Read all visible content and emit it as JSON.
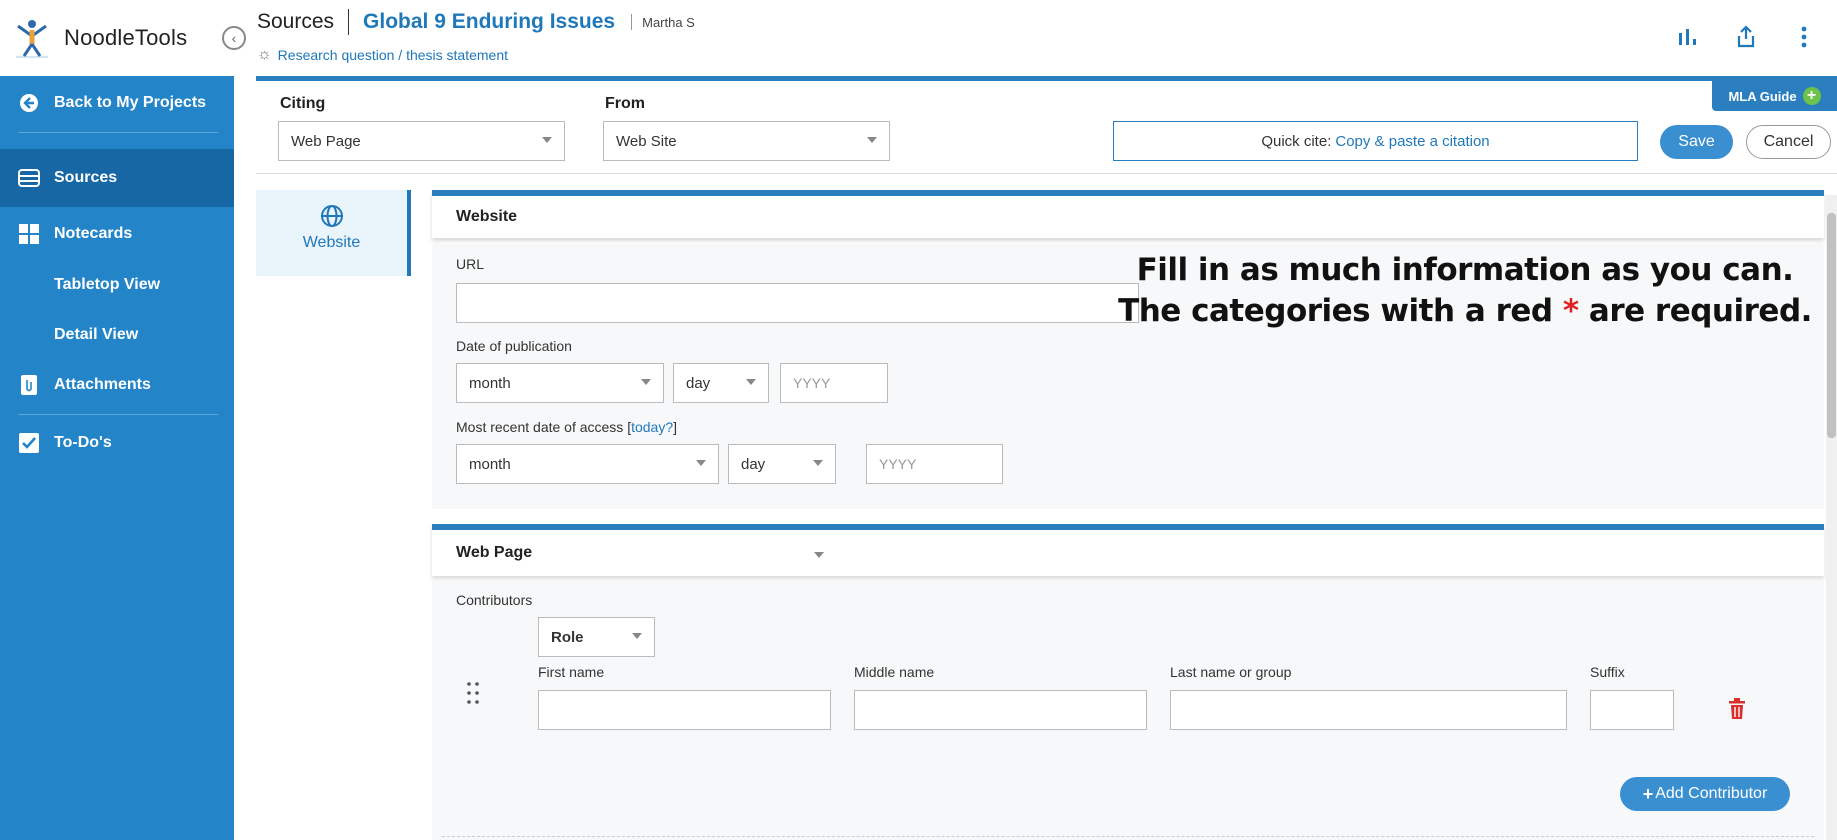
{
  "header": {
    "app_name": "NoodleTools",
    "section": "Sources",
    "project_title": "Global 9 Enduring Issues",
    "user_name": "Martha S",
    "research_link": "Research question / thesis statement",
    "icons": [
      "bar-chart-icon",
      "share-icon",
      "more-vert-icon"
    ]
  },
  "sidebar": {
    "back": "Back to My Projects",
    "sources": "Sources",
    "notecards": "Notecards",
    "tabletop": "Tabletop View",
    "detail": "Detail View",
    "attachments": "Attachments",
    "todos": "To-Do's"
  },
  "citing": {
    "citing_label": "Citing",
    "citing_value": "Web Page",
    "from_label": "From",
    "from_value": "Web Site",
    "quick_cite_prefix": "Quick cite:",
    "quick_cite_link": "Copy & paste a citation",
    "save": "Save",
    "cancel": "Cancel",
    "mla_guide": "MLA Guide"
  },
  "left_tab": {
    "label": "Website"
  },
  "website_panel": {
    "title": "Website",
    "url_label": "URL",
    "url_value": "",
    "pub_date_label": "Date of publication",
    "pub_month": "month",
    "pub_day": "day",
    "pub_year_placeholder": "YYYY",
    "access_label_prefix": "Most recent date of access [",
    "access_today": "today?",
    "access_label_suffix": "]",
    "access_month": "month",
    "access_day": "day",
    "access_year_placeholder": "YYYY"
  },
  "instructions": {
    "line1": "Fill in as much information as you can.",
    "line2_prefix": "The categories with a red",
    "line2_star": "*",
    "line2_suffix": "are required."
  },
  "webpage_panel": {
    "title": "Web Page",
    "contributors_label": "Contributors",
    "role": "Role",
    "first_name": "First name",
    "middle_name": "Middle name",
    "last_name": "Last name or group",
    "suffix": "Suffix",
    "add_contributor": "Add Contributor"
  },
  "colors": {
    "sidebar_bg": "#2385c8",
    "sidebar_active": "#1667a3",
    "accent": "#1f78b9",
    "button": "#3a8fd0",
    "delete": "#d9302c",
    "required_star": "#e0201f"
  }
}
